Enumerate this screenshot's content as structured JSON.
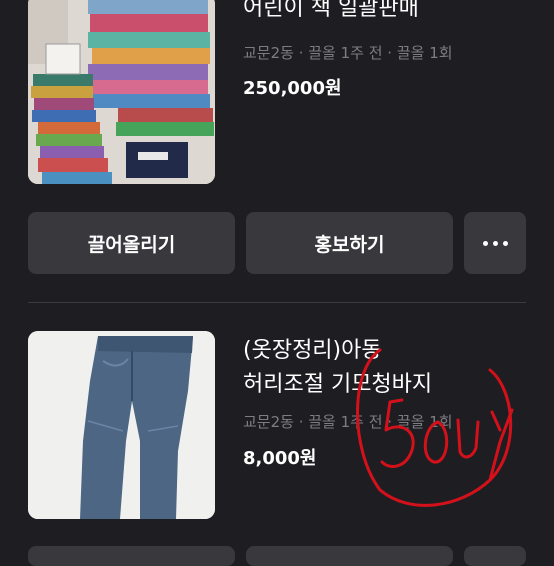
{
  "listings": [
    {
      "title": "어린이 책 일괄판매",
      "meta": "교문2동 · 끌올 1주 전 · 끌올 1회",
      "price": "250,000원",
      "buttons": {
        "bump": "끌어올리기",
        "promote": "홍보하기",
        "more": "more-icon"
      }
    },
    {
      "title_line1": "(옷장정리)아동",
      "title_line2": "허리조절 기모청바지",
      "meta": "교문2동 · 끌올 1주 전 · 끌올 1회",
      "price": "8,000원",
      "annotation": "5OUY"
    }
  ],
  "colors": {
    "background": "#1e1e22",
    "button": "#38383d",
    "meta": "#7c7c84",
    "annotation": "#d4111b"
  }
}
